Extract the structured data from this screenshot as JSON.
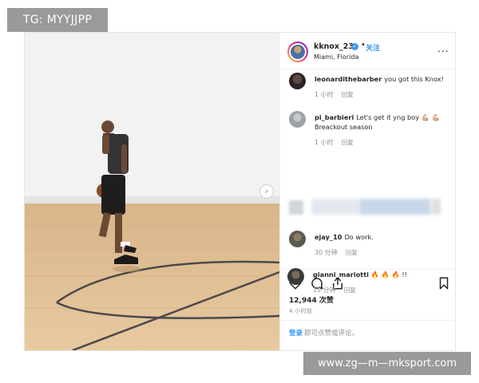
{
  "post": {
    "username": "kknox_23",
    "follow_label": "关注",
    "dot": "•",
    "location": "Miami, Florida",
    "more_label": "...",
    "image_icon": "photo-basketball-player-on-court",
    "next_icon": "chevron-right-icon"
  },
  "comments": [
    {
      "user": "leonardithebarber",
      "text": "you got this Knox!",
      "time": "1 小时",
      "reply": "回复"
    },
    {
      "user": "pi_barbieri",
      "text": "Let's get it yng boy 💪🏼 💪🏼 Breackout season",
      "time": "1 小时",
      "reply": "回复"
    },
    {
      "user": "ejay_10",
      "text": "Do work.",
      "time": "30 分钟",
      "reply": "回复"
    },
    {
      "user": "gianni_mariotti",
      "text": "🔥 🔥 🔥 !!",
      "time": "19 分钟",
      "reply": "回复"
    }
  ],
  "stats": {
    "likes": "12,944 次赞",
    "posted": "4 小时前"
  },
  "login": {
    "link": "登录",
    "rest": "即可点赞或评论。"
  },
  "icons": {
    "like": "heart-icon",
    "comment": "comment-bubble-icon",
    "share": "share-icon",
    "save": "bookmark-icon",
    "verified": "verified-badge-icon"
  },
  "watermarks": {
    "top": "TG: MYYJJPP",
    "bottom": "www.zg—m—mksport.com"
  },
  "colors": {
    "link_blue": "#3897f0",
    "text_dark": "#262626",
    "text_gray": "#8e8e8e"
  }
}
